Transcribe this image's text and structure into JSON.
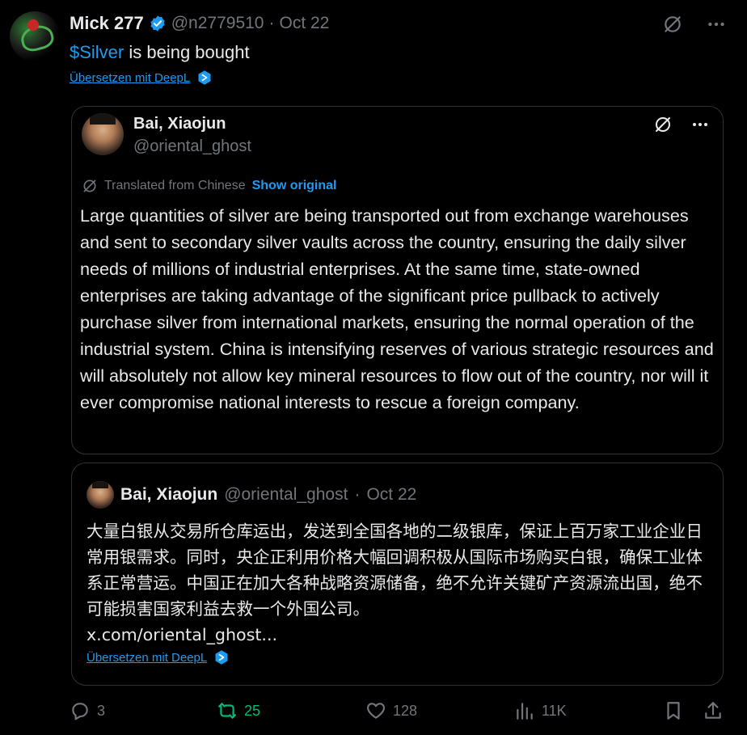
{
  "tweet": {
    "display_name": "Mick 277",
    "handle": "@n2779510",
    "separator": "·",
    "date": "Oct 22",
    "text_cashtag": "$Silver",
    "text_rest": " is being bought",
    "translate_link": "Übersetzen mit DeepL"
  },
  "quote_main": {
    "name": "Bai, Xiaojun",
    "handle": "@oriental_ghost",
    "translated_label": "Translated from Chinese",
    "show_original": "Show original",
    "body": "Large quantities of silver are being transported out from exchange warehouses and sent to secondary silver vaults across the country, ensuring the daily silver needs of millions of industrial enterprises. At the same time, state-owned enterprises are taking advantage of the significant price pullback to actively purchase silver from international markets, ensuring the normal operation of the industrial system. China is intensifying reserves of various strategic resources and will absolutely not allow key mineral resources to flow out of the country, nor will it ever compromise national interests to rescue a foreign company."
  },
  "quote_original": {
    "name": "Bai, Xiaojun",
    "handle": "@oriental_ghost",
    "separator": "·",
    "date": "Oct 22",
    "body": "大量白银从交易所仓库运出，发送到全国各地的二级银库，保证上百万家工业企业日常用银需求。同时，央企正利用价格大幅回调积极从国际市场购买白银，确保工业体系正常营运。中国正在加大各种战略资源储备，绝不允许关键矿产资源流出国，绝不可能损害国家利益去救一个外国公司。",
    "link": "x.com/oriental_ghost...",
    "translate_link": "Übersetzen mit DeepL"
  },
  "actions": {
    "replies": "3",
    "reposts": "25",
    "likes": "128",
    "views": "11K"
  },
  "colors": {
    "accent": "#1d9bf0",
    "muted": "#71767b",
    "repost_active": "#00ba7c",
    "border": "#2f3336"
  }
}
